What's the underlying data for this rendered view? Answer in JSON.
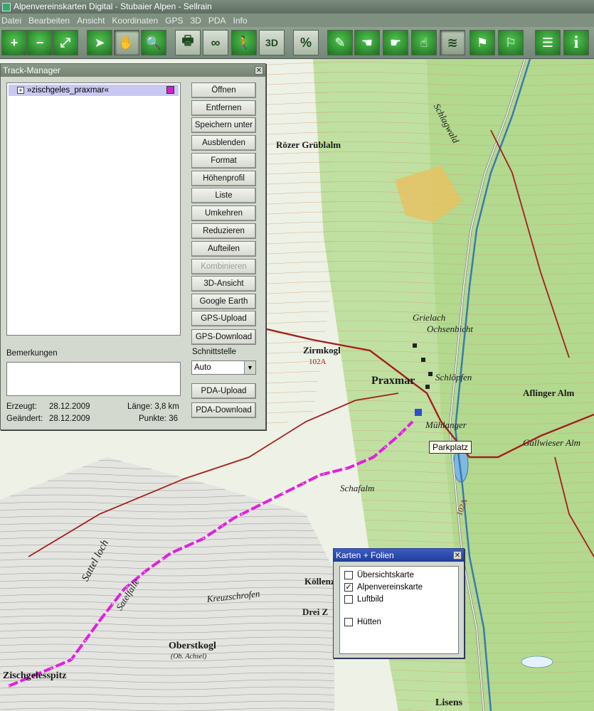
{
  "titlebar": {
    "title": "Alpenvereinskarten Digital - Stubaier Alpen - Sellrain"
  },
  "menu": [
    "Datei",
    "Bearbeiten",
    "Ansicht",
    "Koordinaten",
    "GPS",
    "3D",
    "PDA",
    "Info"
  ],
  "toolbar": {
    "buttons": [
      {
        "name": "zoom-in-icon",
        "glyph": "+"
      },
      {
        "name": "zoom-out-icon",
        "glyph": "−"
      },
      {
        "name": "fit-map-icon",
        "glyph": "⤢"
      },
      {
        "name": "select-arrow-icon",
        "glyph": "➤"
      },
      {
        "name": "pan-hand-icon",
        "glyph": "✋"
      },
      {
        "name": "magnifier-icon",
        "glyph": "🔍"
      },
      {
        "name": "print-icon",
        "glyph": "🖶"
      },
      {
        "name": "binoculars-icon",
        "glyph": "∞"
      },
      {
        "name": "hiker-icon",
        "glyph": "🚶"
      },
      {
        "name": "3d-view-icon",
        "glyph": "3D"
      },
      {
        "name": "profile-percent-icon",
        "glyph": "%"
      },
      {
        "name": "draw-track-icon",
        "glyph": "✎"
      },
      {
        "name": "hand-point-icon",
        "glyph": "☚"
      },
      {
        "name": "hand-edit-icon",
        "glyph": "☛"
      },
      {
        "name": "hand-select-icon",
        "glyph": "☝"
      },
      {
        "name": "track-layers-icon",
        "glyph": "≋"
      },
      {
        "name": "waypoint-flag-icon",
        "glyph": "⚑"
      },
      {
        "name": "route-flag-icon",
        "glyph": "⚐"
      },
      {
        "name": "legend-list-icon",
        "glyph": "☰"
      },
      {
        "name": "info-icon",
        "glyph": "i"
      }
    ]
  },
  "track_manager": {
    "title": "Track-Manager",
    "tracks": [
      {
        "name": "»zischgeles_praxmar«",
        "color": "#d01fd0"
      }
    ],
    "buttons": {
      "open": "Öffnen",
      "remove": "Entfernen",
      "save_as": "Speichern unter",
      "hide": "Ausblenden",
      "format": "Format",
      "profile": "Höhenprofil",
      "list": "Liste",
      "reverse": "Umkehren",
      "reduce": "Reduzieren",
      "split": "Aufteilen",
      "combine": "Kombinieren",
      "view3d": "3D-Ansicht",
      "google_earth": "Google Earth",
      "gps_upload": "GPS-Upload",
      "gps_download": "GPS-Download",
      "pda_upload": "PDA-Upload",
      "pda_download": "PDA-Download"
    },
    "remarks_label": "Bemerkungen",
    "interface_label": "Schnittstelle",
    "interface_value": "Auto",
    "created_label": "Erzeugt:",
    "created_value": "28.12.2009",
    "changed_label": "Geändert:",
    "changed_value": "28.12.2009",
    "length_text": "Länge: 3,8 km",
    "points_text": "Punkte: 36"
  },
  "karten": {
    "title": "Karten + Folien",
    "items": [
      {
        "label": "Übersichtskarte",
        "checked": false
      },
      {
        "label": "Alpenvereinskarte",
        "checked": true
      },
      {
        "label": "Luftbild",
        "checked": false
      },
      {
        "label": "Hütten",
        "checked": false
      }
    ]
  },
  "map": {
    "tooltip": "Parkplatz",
    "labels": {
      "praxmar": "Praxmar",
      "zischgelesspitz": "Zischgelesspitz",
      "oberstkogl": "Oberstkogl",
      "oberstkogl_sub": "(Ob. Achsel)",
      "lisens": "Lisens",
      "schlagwald": "Schlagwald",
      "groe_gruebl": "Rözer Grüblalm",
      "sattelloch": "Sattel loch",
      "sattelfalle": "Satelfalle",
      "kreuzschrofen": "Kreuzschrofen",
      "ochsenbicht": "Ochsenbicht",
      "muehlanger": "Mühlanger",
      "gallwieser": "Gallwieser Alm",
      "aflinger": "Aflinger Alm",
      "zirmkogl": "Zirmkogl",
      "kollenzen": "Köllenz",
      "dreiz": "Drei Z",
      "schafalm": "Schafalm",
      "schlopfen": "Schlöpfen",
      "grielach": "Grielach",
      "route_102a": "102A",
      "route_102a_b": "102A"
    }
  }
}
